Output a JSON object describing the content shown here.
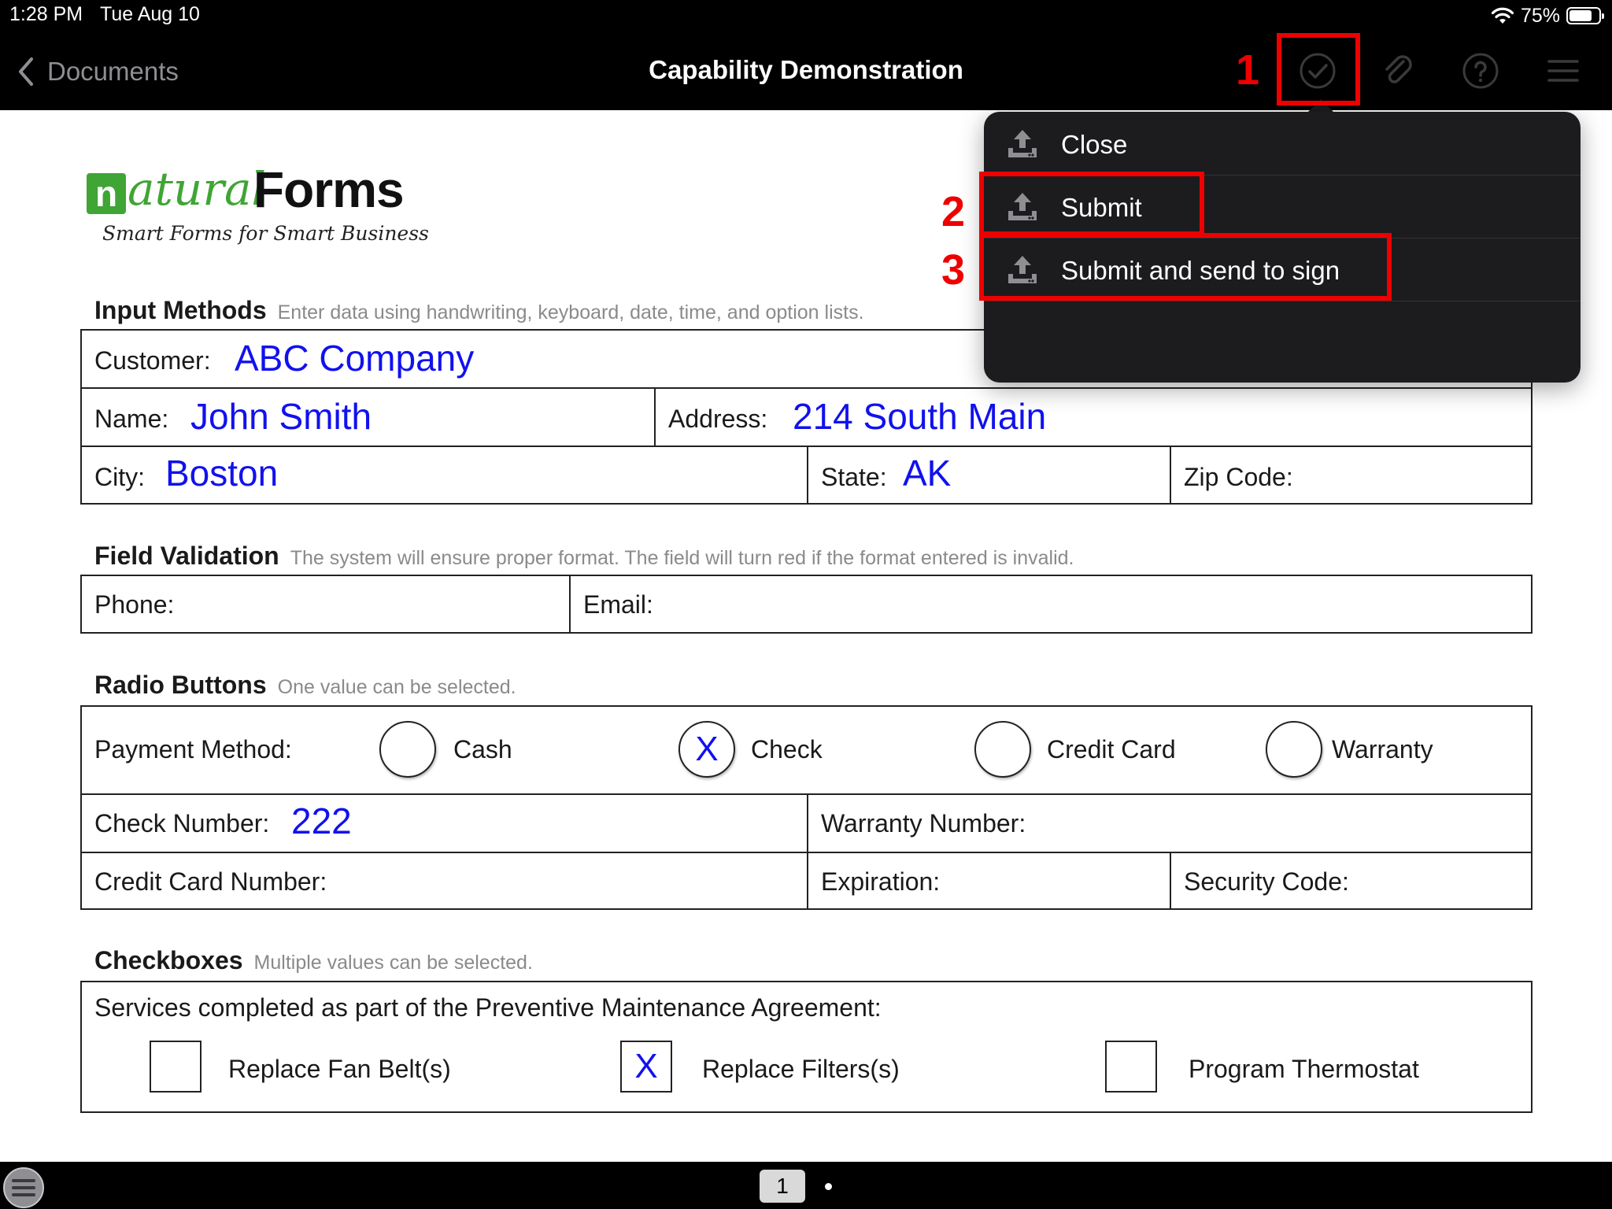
{
  "status_bar": {
    "time": "1:28 PM",
    "date": "Tue Aug 10",
    "battery": "75%",
    "battery_level": 0.75
  },
  "nav": {
    "back_label": "Documents",
    "title": "Capability Demonstration",
    "icons": [
      "checkmark-circle-icon",
      "paperclip-icon",
      "help-icon",
      "hamburger-menu-icon"
    ]
  },
  "annotations": {
    "callout_1": "1",
    "callout_2": "2",
    "callout_3": "3",
    "color": "#ee0000"
  },
  "menu": {
    "items": [
      {
        "label": "Close",
        "icon": "upload-tray-icon"
      },
      {
        "label": "Submit",
        "icon": "upload-tray-icon"
      },
      {
        "label": "Submit and send to sign",
        "icon": "upload-tray-icon"
      }
    ]
  },
  "logo": {
    "word1": "atural",
    "letter": "n",
    "word2": "Forms",
    "tagline": "Smart Forms for Smart Business",
    "brand_green": "#3fa535"
  },
  "sections": {
    "input": {
      "title": "Input Methods",
      "desc": "Enter data using handwriting, keyboard, date, time, and option lists.",
      "customer_label": "Customer:",
      "customer_value": "ABC Company",
      "name_label": "Name:",
      "name_value": "John Smith",
      "address_label": "Address:",
      "address_value": "214 South Main",
      "city_label": "City:",
      "city_value": "Boston",
      "state_label": "State:",
      "state_value": "AK",
      "zip_label": "Zip Code:"
    },
    "validation": {
      "title": "Field Validation",
      "desc": "The system will ensure proper format. The field will turn red if the format entered is invalid.",
      "phone_label": "Phone:",
      "email_label": "Email:"
    },
    "radio": {
      "title": "Radio Buttons",
      "desc": "One value can be selected.",
      "payment_label": "Payment Method:",
      "options": [
        "Cash",
        "Check",
        "Credit Card",
        "Warranty"
      ],
      "selected": "Check",
      "mark": "X",
      "check_number_label": "Check Number:",
      "check_number_value": "222",
      "warranty_number_label": "Warranty Number:",
      "cc_number_label": "Credit Card Number:",
      "expiration_label": "Expiration:",
      "security_code_label": "Security Code:"
    },
    "checkboxes": {
      "title": "Checkboxes",
      "desc": "Multiple values can be selected.",
      "prompt": "Services completed as part of the Preventive Maintenance Agreement:",
      "items": [
        {
          "label": "Replace Fan Belt(s)",
          "checked": false
        },
        {
          "label": "Replace Filters(s)",
          "checked": true
        },
        {
          "label": "Program Thermostat",
          "checked": false
        }
      ],
      "mark": "X"
    }
  },
  "bottom_bar": {
    "page_number": "1"
  },
  "colors": {
    "ink_blue": "#1111ee",
    "menu_bg": "#1c1c1e",
    "nav_bg": "#000000"
  }
}
